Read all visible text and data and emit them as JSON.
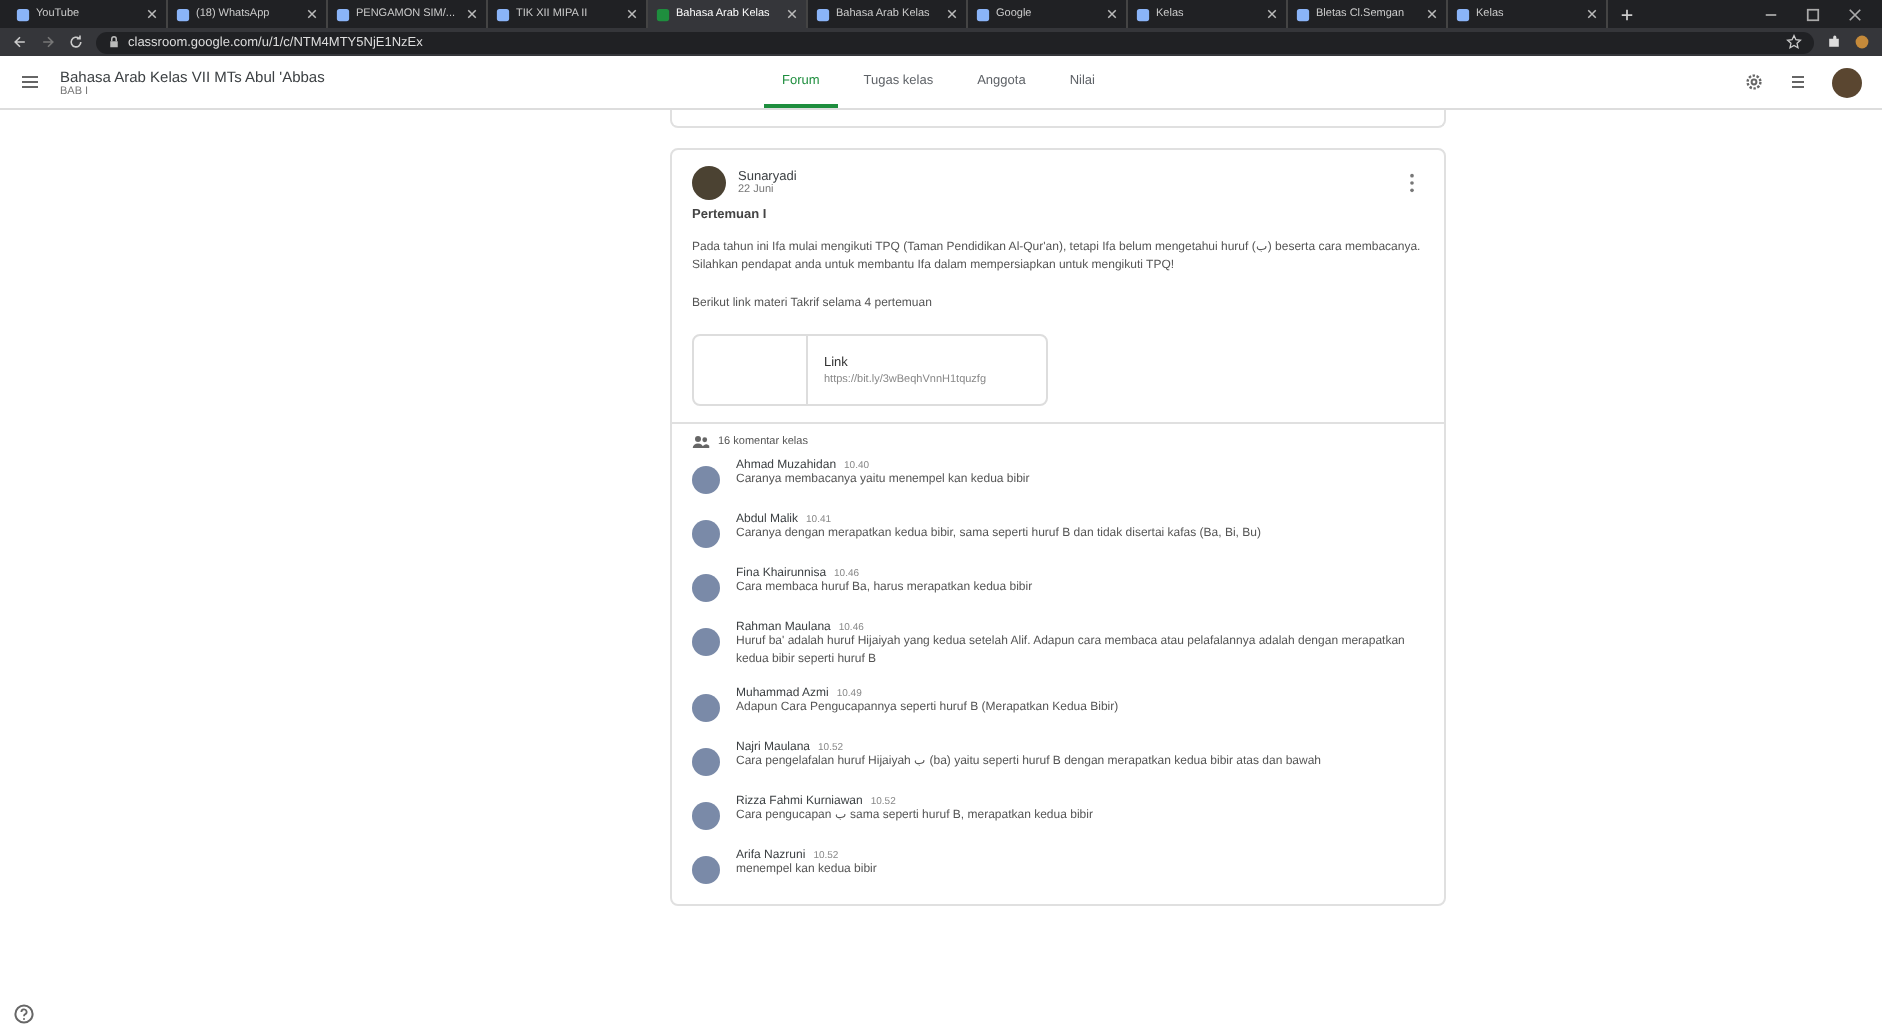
{
  "browser": {
    "tabs": [
      {
        "title": "YouTube",
        "selected": false
      },
      {
        "title": "(18) WhatsApp",
        "selected": false
      },
      {
        "title": "PENGAMON SIM/...",
        "selected": false
      },
      {
        "title": "TIK XII MIPA II",
        "selected": false
      },
      {
        "title": "Bahasa Arab Kelas",
        "selected": true
      },
      {
        "title": "Bahasa Arab Kelas",
        "selected": false
      },
      {
        "title": "Google",
        "selected": false
      },
      {
        "title": "Kelas",
        "selected": false
      },
      {
        "title": "Bletas Cl.Semgan",
        "selected": false
      },
      {
        "title": "Kelas",
        "selected": false
      }
    ],
    "address": "classroom.google.com/u/1/c/NTM4MTY5NjE1NzEx"
  },
  "header": {
    "class_name": "Bahasa Arab Kelas VII MTs Abul 'Abbas",
    "section": "BAB I",
    "nav": [
      {
        "label": "Forum",
        "selected": true
      },
      {
        "label": "Tugas kelas",
        "selected": false
      },
      {
        "label": "Anggota",
        "selected": false
      },
      {
        "label": "Nilai",
        "selected": false
      }
    ]
  },
  "post": {
    "author": "Sunaryadi",
    "date": "22 Juni",
    "title": "Pertemuan I",
    "body": "Pada tahun ini Ifa mulai mengikuti TPQ (Taman Pendidikan Al-Qur'an), tetapi Ifa belum mengetahui huruf (ب) beserta cara membacanya. Silahkan pendapat anda untuk membantu Ifa dalam mempersiapkan untuk mengikuti TPQ!",
    "intro": "Berikut link materi Takrif selama 4 pertemuan",
    "attachment": {
      "title": "Link",
      "url": "https://bit.ly/3wBeqhVnnH1tquzfg"
    },
    "comments_label": "16 komentar kelas",
    "comments": [
      {
        "name": "Ahmad Muzahidan",
        "time": "10.40",
        "text": "Caranya membacanya yaitu menempel kan kedua bibir"
      },
      {
        "name": "Abdul Malik",
        "time": "10.41",
        "text": "Caranya dengan merapatkan kedua bibir, sama seperti huruf B dan tidak disertai kafas (Ba, Bi, Bu)"
      },
      {
        "name": "Fina Khairunnisa",
        "time": "10.46",
        "text": "Cara membaca huruf Ba, harus merapatkan kedua bibir"
      },
      {
        "name": "Rahman Maulana",
        "time": "10.46",
        "text": "Huruf ba' adalah huruf Hijaiyah yang kedua setelah Alif. Adapun cara membaca atau pelafalannya adalah dengan merapatkan kedua bibir seperti huruf B"
      },
      {
        "name": "Muhammad Azmi",
        "time": "10.49",
        "text": "Adapun Cara Pengucapannya seperti huruf B (Merapatkan Kedua Bibir)"
      },
      {
        "name": "Najri Maulana",
        "time": "10.52",
        "text": "Cara pengelafalan huruf Hijaiyah ب (ba) yaitu seperti huruf B dengan merapatkan kedua bibir atas dan bawah"
      },
      {
        "name": "Rizza Fahmi Kurniawan",
        "time": "10.52",
        "text": "Cara pengucapan ب sama seperti huruf B, merapatkan kedua bibir"
      },
      {
        "name": "Arifa Nazruni",
        "time": "10.52",
        "text": "menempel kan kedua bibir"
      }
    ]
  }
}
